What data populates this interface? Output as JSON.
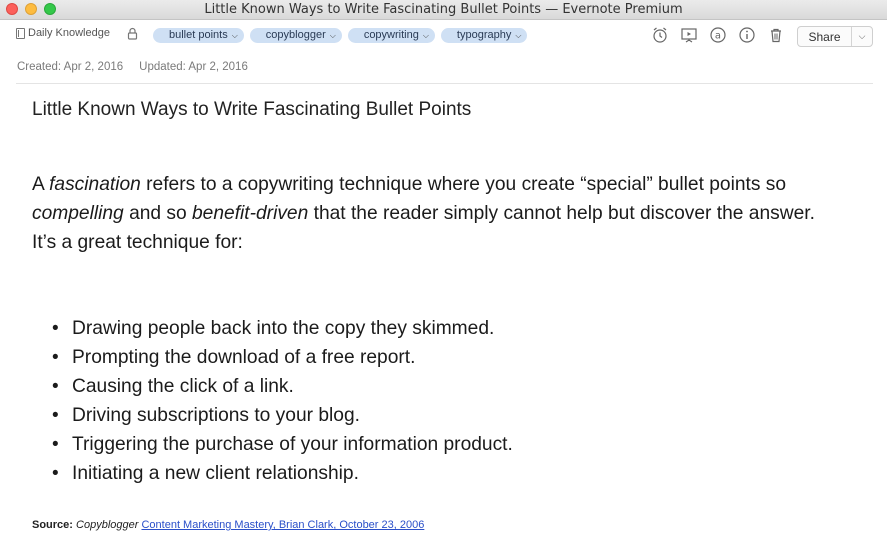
{
  "window": {
    "title": "Little Known Ways to Write Fascinating Bullet Points — Evernote Premium"
  },
  "toolbar": {
    "notebook": "Daily Knowledge",
    "tags": [
      "bullet points",
      "copyblogger",
      "copywriting",
      "typography"
    ],
    "icons": [
      "reminder-icon",
      "present-icon",
      "mention-icon",
      "info-icon",
      "trash-icon"
    ],
    "share_label": "Share"
  },
  "meta": {
    "created": "Created: Apr 2, 2016",
    "updated": "Updated: Apr 2, 2016"
  },
  "note": {
    "title": "Little Known Ways to Write Fascinating Bullet Points",
    "intro": {
      "p1": "A ",
      "p1_em": "fascination",
      "p2": " refers to a copywriting technique where you create “special” bullet points so ",
      "p2_em": "compelling",
      "p3": " and so ",
      "p3_em": "benefit-driven",
      "p4": " that the reader simply cannot help but discover the answer."
    },
    "lead": "It’s a great technique for:",
    "bullets": [
      "Drawing people back into the copy they skimmed.",
      "Prompting the download of a free report.",
      "Causing the click of a link.",
      "Driving subscriptions to your blog.",
      "Triggering the purchase of your information product.",
      "Initiating a new client relationship."
    ],
    "source": {
      "label": "Source:",
      "publisher": "Copyblogger",
      "link": "Content Marketing Mastery, Brian Clark, October 23, 2006"
    }
  },
  "colors": {
    "tag_bg": "#cfe0f4",
    "link": "#2a4fc9"
  }
}
